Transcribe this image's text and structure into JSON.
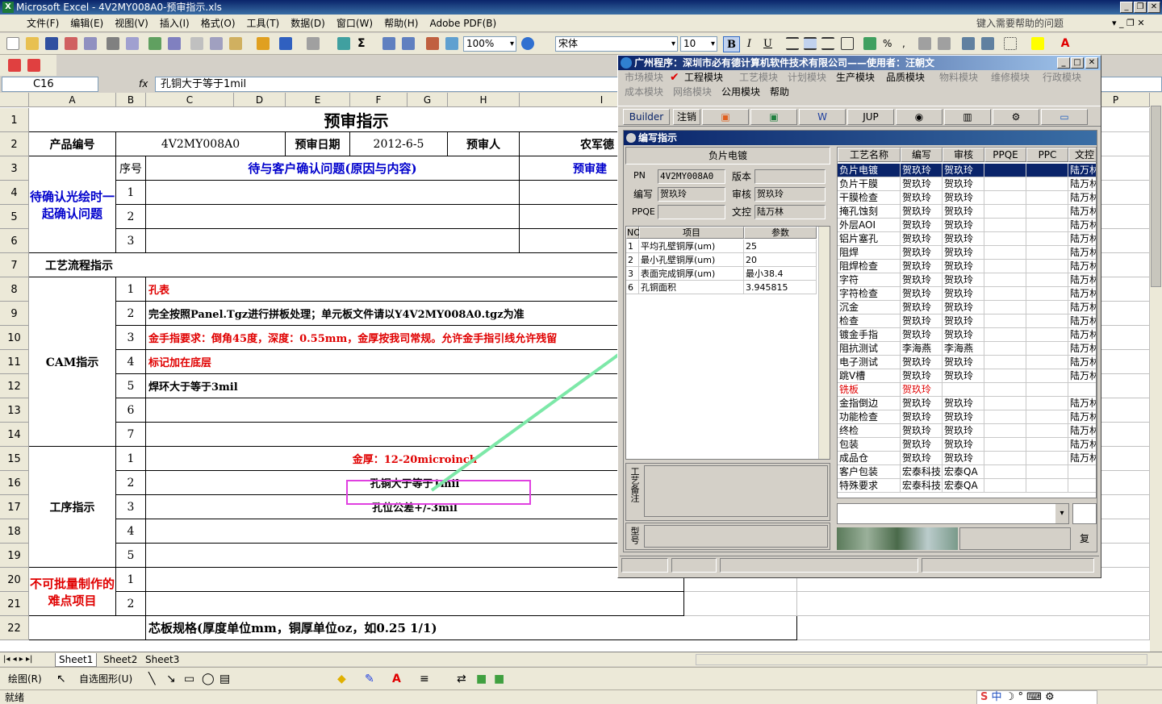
{
  "window": {
    "title": "Microsoft Excel - 4V2MY008A0-预审指示.xls",
    "help_placeholder": "键入需要帮助的问题"
  },
  "menu": [
    "文件(F)",
    "编辑(E)",
    "视图(V)",
    "插入(I)",
    "格式(O)",
    "工具(T)",
    "数据(D)",
    "窗口(W)",
    "帮助(H)",
    "Adobe PDF(B)"
  ],
  "toolbar": {
    "zoom": "100%",
    "font": "宋体",
    "size": "10"
  },
  "namebox": "C16",
  "formula": "孔铜大于等于1mil",
  "columns": [
    "A",
    "B",
    "C",
    "D",
    "E",
    "F",
    "G",
    "H",
    "I",
    "P"
  ],
  "rows": [
    "1",
    "2",
    "3",
    "4",
    "5",
    "6",
    "7",
    "8",
    "9",
    "10",
    "11",
    "12",
    "13",
    "14",
    "15",
    "16",
    "17",
    "18",
    "19",
    "20",
    "21",
    "22"
  ],
  "sheet": {
    "title": "预审指示",
    "product_label": "产品编号",
    "product_value": "4V2MY008A0",
    "date_label": "预审日期",
    "date_value": "2012-6-5",
    "reviewer_label": "预审人",
    "reviewer_value": "农军德",
    "pending_label": "待确认光绘时一起确认问题",
    "seq_label": "序号",
    "issue_header": "待与客户确认问题(原因与内容)",
    "suggest_header": "预审建",
    "issue_rows": [
      "1",
      "2",
      "3"
    ],
    "process_label": "工艺流程指示",
    "cam_label": "CAM指示",
    "cam_rows": [
      {
        "n": "1",
        "text": "孔表",
        "red": true
      },
      {
        "n": "2",
        "text": "完全按照Panel.Tgz进行拼板处理；单元板文件请以Y4V2MY008A0.tgz为准",
        "red": false
      },
      {
        "n": "3",
        "text": "金手指要求：倒角45度，深度：0.55mm，金厚按我司常规。允许金手指引线允许残留",
        "red": true
      },
      {
        "n": "4",
        "text": "标记加在底层",
        "red": true
      },
      {
        "n": "5",
        "text": "焊环大于等于3mil",
        "red": false
      },
      {
        "n": "6",
        "text": "",
        "red": false
      },
      {
        "n": "7",
        "text": "",
        "red": false
      }
    ],
    "proc_label": "工序指示",
    "proc_rows": [
      {
        "n": "1",
        "text": "金厚：12-20microinch",
        "red": true
      },
      {
        "n": "2",
        "text": "孔铜大于等于1mil",
        "red": false
      },
      {
        "n": "3",
        "text": "孔位公差+/-3mil",
        "red": false
      },
      {
        "n": "4",
        "text": "",
        "red": false
      },
      {
        "n": "5",
        "text": "",
        "red": false
      }
    ],
    "difficult_label": "不可批量制作的难点项目",
    "difficult_rows": [
      "1",
      "2"
    ],
    "core_text": "芯板规格(厚度单位mm，铜厚单位oz，如0.25 1/1)"
  },
  "tabs": [
    "Sheet1",
    "Sheet2",
    "Sheet3"
  ],
  "draw": {
    "draw_label": "绘图(R)",
    "autoshape_label": "自选图形(U)"
  },
  "status": "就绪",
  "app": {
    "title": "广州程序：深圳市必有德计算机软件技术有限公司——使用者：汪朝文",
    "menu_row1": [
      {
        "label": "市场模块",
        "active": false
      },
      {
        "label": "工程模块",
        "active": true
      },
      {
        "label": "工艺模块",
        "active": false
      },
      {
        "label": "计划模块",
        "active": false
      },
      {
        "label": "生产模块",
        "active": true
      },
      {
        "label": "品质模块",
        "active": true
      },
      {
        "label": "物料模块",
        "active": false
      },
      {
        "label": "维修模块",
        "active": false
      },
      {
        "label": "行政模块",
        "active": false
      }
    ],
    "menu_row2": [
      {
        "label": "成本模块",
        "active": false
      },
      {
        "label": "网络模块",
        "active": false
      },
      {
        "label": "公用模块",
        "active": true
      },
      {
        "label": "帮助",
        "active": true
      }
    ],
    "toolbar": {
      "builder": "Builder",
      "logout": "注销",
      "jup": "JUP"
    },
    "child_title": "编写指示",
    "section": "负片电镀",
    "pn_label": "PN",
    "pn_value": "4V2MY008A0",
    "version_label": "版本",
    "version_value": "",
    "writer_label": "编写",
    "writer_value": "贺玖玲",
    "checker_label": "审核",
    "checker_value": "贺玖玲",
    "ppqe_label": "PPQE",
    "ppqe_value": "",
    "dc_label": "文控",
    "dc_value": "陆万林",
    "param_headers": [
      "NO",
      "项目",
      "参数"
    ],
    "params": [
      {
        "no": "1",
        "item": "平均孔壁铜厚(um)",
        "value": "25"
      },
      {
        "no": "2",
        "item": "最小孔壁铜厚(um)",
        "value": "20"
      },
      {
        "no": "3",
        "item": "表面完成铜厚(um)",
        "value": "最小38.4"
      },
      {
        "no": "6",
        "item": "孔铜面积",
        "value": "3.945815"
      }
    ],
    "remark_label": "工艺备注",
    "model_label": "型号",
    "proc_headers": [
      "工艺名称",
      "编写",
      "审核",
      "PPQE",
      "PPC",
      "文控"
    ],
    "processes": [
      {
        "name": "负片电镀",
        "w": "贺玖玲",
        "c": "贺玖玲",
        "d": "陆万林",
        "sel": true
      },
      {
        "name": "负片干膜",
        "w": "贺玖玲",
        "c": "贺玖玲",
        "d": "陆万林"
      },
      {
        "name": "干膜检查",
        "w": "贺玖玲",
        "c": "贺玖玲",
        "d": "陆万林"
      },
      {
        "name": "掩孔蚀刻",
        "w": "贺玖玲",
        "c": "贺玖玲",
        "d": "陆万林"
      },
      {
        "name": "外层AOI",
        "w": "贺玖玲",
        "c": "贺玖玲",
        "d": "陆万林"
      },
      {
        "name": "铝片塞孔",
        "w": "贺玖玲",
        "c": "贺玖玲",
        "d": "陆万林"
      },
      {
        "name": "阻焊",
        "w": "贺玖玲",
        "c": "贺玖玲",
        "d": "陆万林"
      },
      {
        "name": "阻焊检查",
        "w": "贺玖玲",
        "c": "贺玖玲",
        "d": "陆万林"
      },
      {
        "name": "字符",
        "w": "贺玖玲",
        "c": "贺玖玲",
        "d": "陆万林"
      },
      {
        "name": "字符检查",
        "w": "贺玖玲",
        "c": "贺玖玲",
        "d": "陆万林"
      },
      {
        "name": "沉金",
        "w": "贺玖玲",
        "c": "贺玖玲",
        "d": "陆万林"
      },
      {
        "name": "检查",
        "w": "贺玖玲",
        "c": "贺玖玲",
        "d": "陆万林"
      },
      {
        "name": "镀金手指",
        "w": "贺玖玲",
        "c": "贺玖玲",
        "d": "陆万林"
      },
      {
        "name": "阻抗测试",
        "w": "李海燕",
        "c": "李海燕",
        "d": "陆万林"
      },
      {
        "name": "电子测试",
        "w": "贺玖玲",
        "c": "贺玖玲",
        "d": "陆万林"
      },
      {
        "name": "跳V槽",
        "w": "贺玖玲",
        "c": "贺玖玲",
        "d": "陆万林"
      },
      {
        "name": "铣板",
        "w": "贺玖玲",
        "c": "",
        "d": "",
        "red": true
      },
      {
        "name": "金指倒边",
        "w": "贺玖玲",
        "c": "贺玖玲",
        "d": "陆万林"
      },
      {
        "name": "功能检查",
        "w": "贺玖玲",
        "c": "贺玖玲",
        "d": "陆万林"
      },
      {
        "name": "终检",
        "w": "贺玖玲",
        "c": "贺玖玲",
        "d": "陆万林"
      },
      {
        "name": "包装",
        "w": "贺玖玲",
        "c": "贺玖玲",
        "d": "陆万林"
      },
      {
        "name": "成品仓",
        "w": "贺玖玲",
        "c": "贺玖玲",
        "d": "陆万林"
      },
      {
        "name": "客户包装",
        "w": "宏泰科技",
        "c": "宏泰QA",
        "d": ""
      },
      {
        "name": "特殊要求",
        "w": "宏泰科技",
        "c": "宏泰QA",
        "d": ""
      }
    ],
    "copy_label": "复"
  },
  "colors": {
    "highlight_box": "#e040e0",
    "arrow": "#7de8a8",
    "red_text": "#e00000",
    "blue_text": "#0000cc",
    "selection": "#0a246a"
  }
}
